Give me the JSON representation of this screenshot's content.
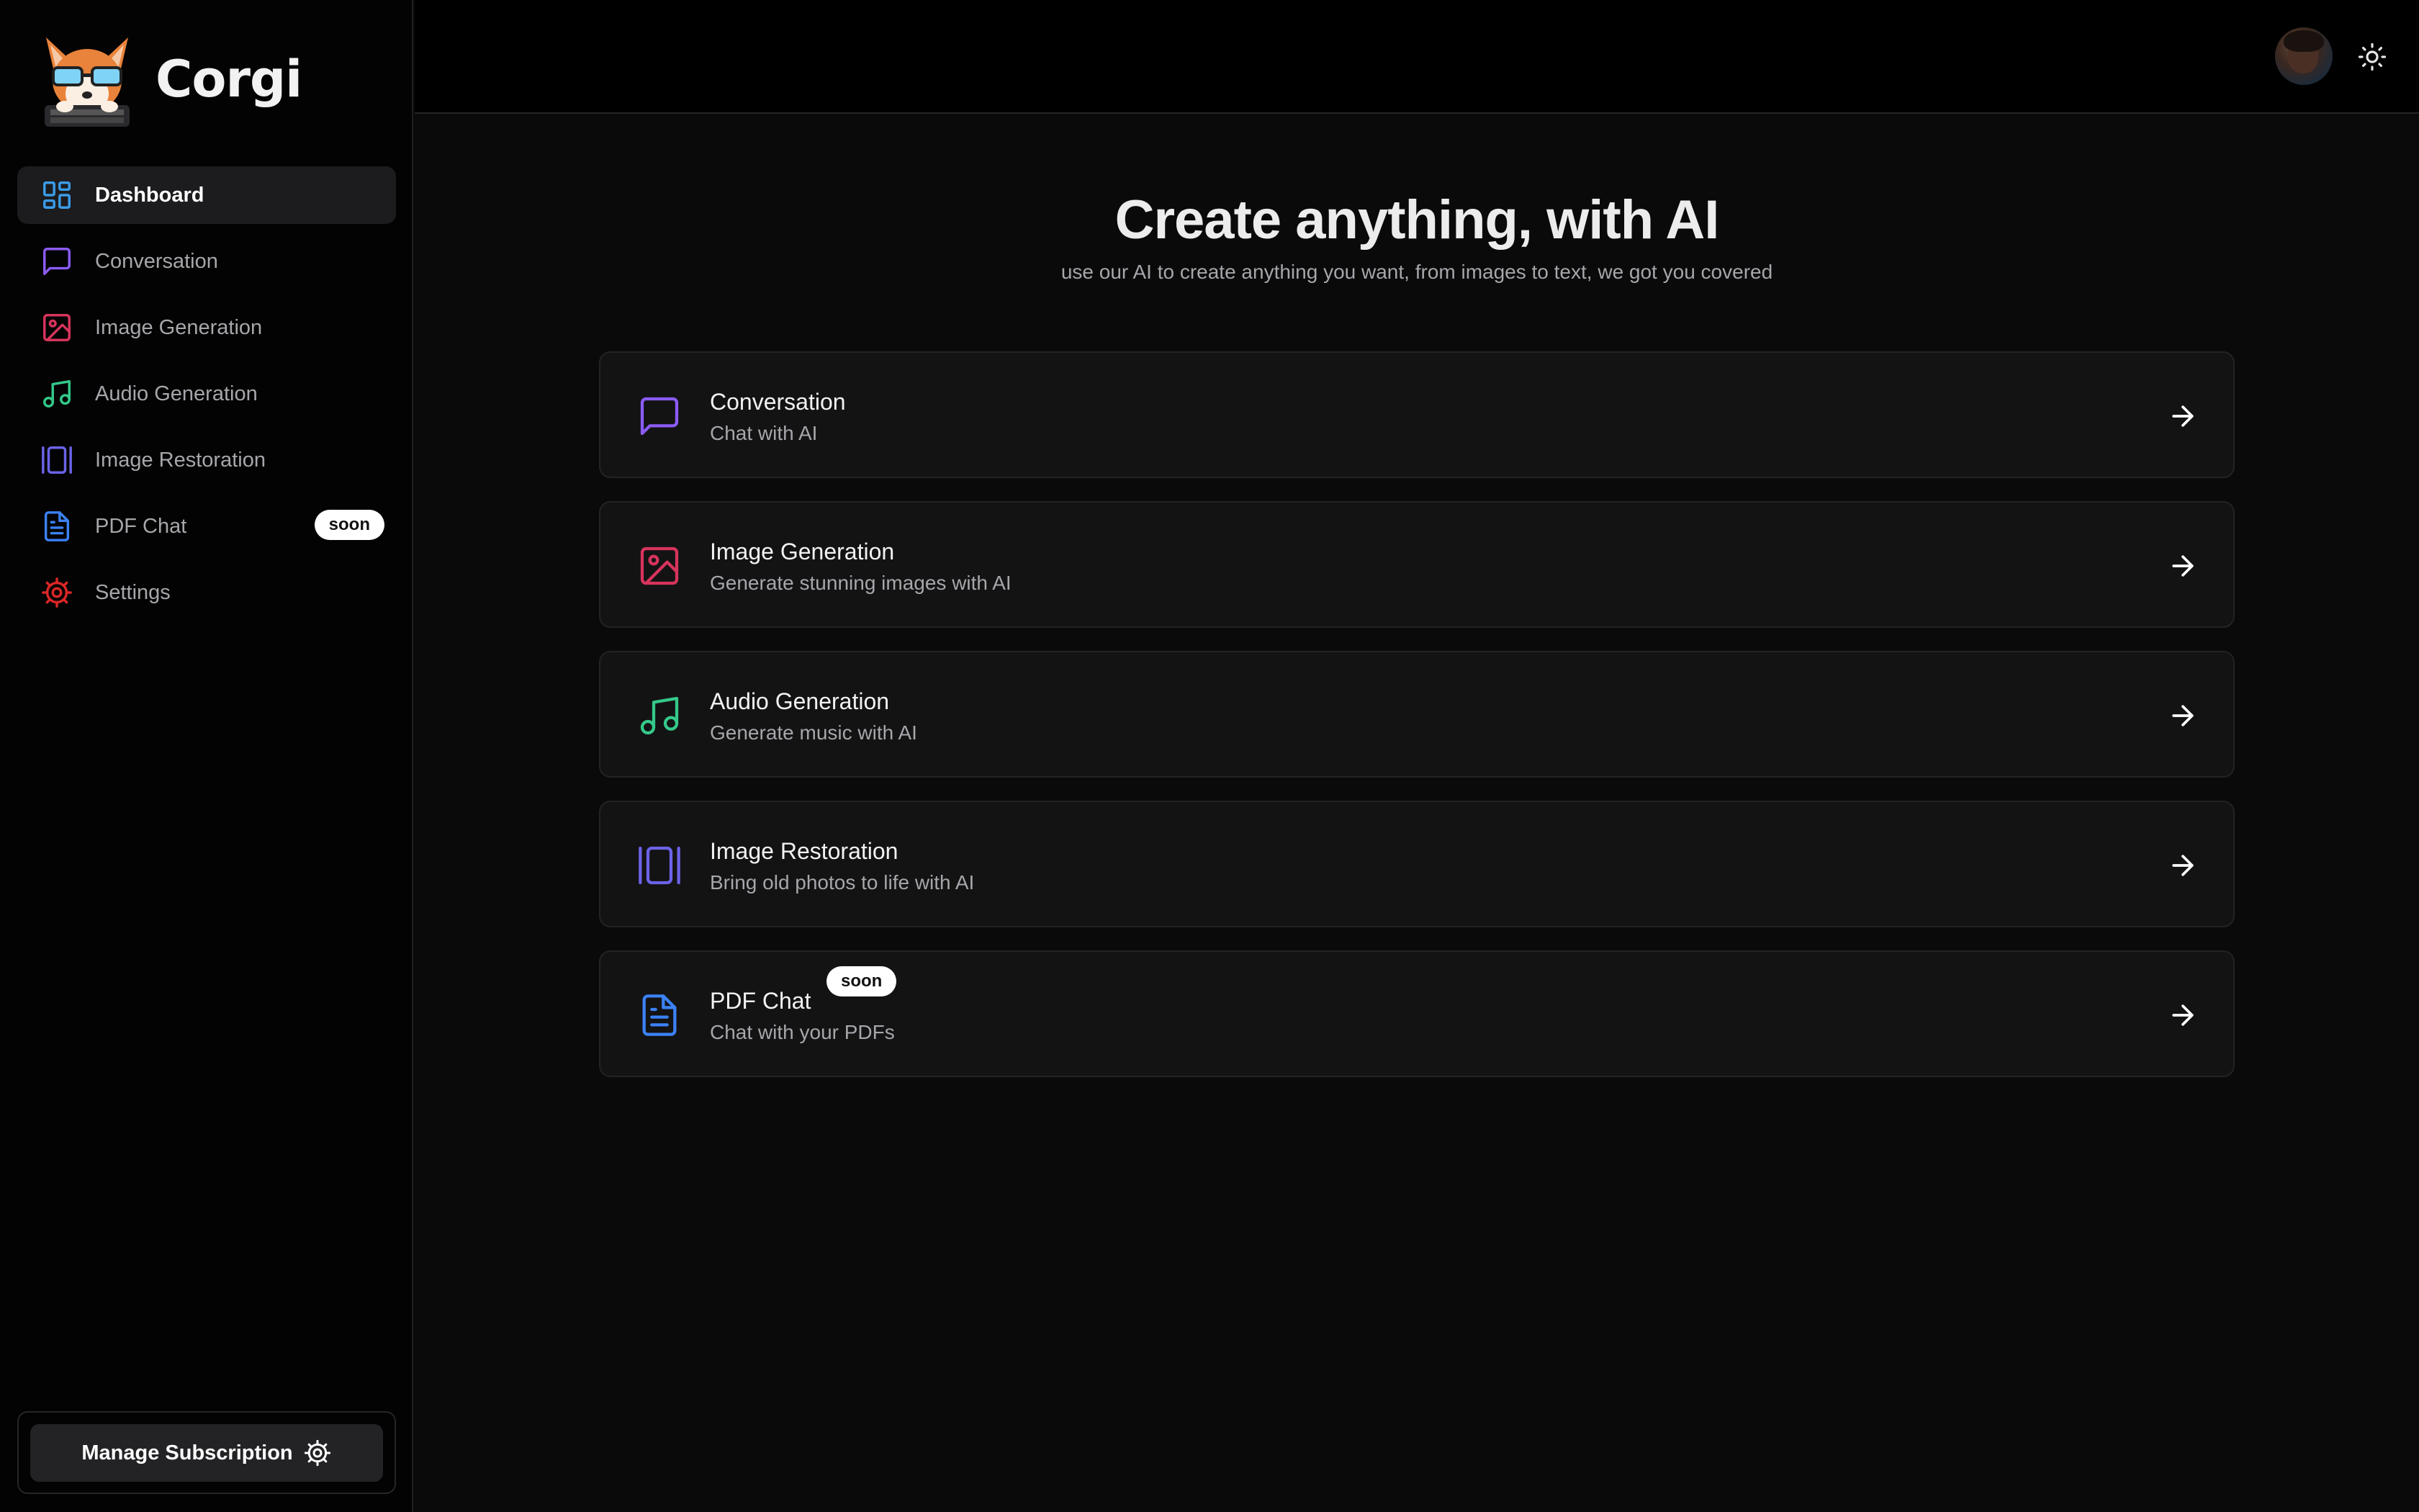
{
  "app": {
    "name": "Corgi"
  },
  "sidebar": {
    "items": [
      {
        "label": "Dashboard",
        "icon": "dashboard-icon",
        "color": "#3b9ce8",
        "active": true
      },
      {
        "label": "Conversation",
        "icon": "message-square-icon",
        "color": "#8b5cf6"
      },
      {
        "label": "Image Generation",
        "icon": "image-icon",
        "color": "#d7345d"
      },
      {
        "label": "Audio Generation",
        "icon": "music-icon",
        "color": "#34c98a"
      },
      {
        "label": "Image Restoration",
        "icon": "gallery-vertical-icon",
        "color": "#6c63e8"
      },
      {
        "label": "PDF Chat",
        "icon": "file-text-icon",
        "color": "#3b82f6",
        "badge": "soon"
      },
      {
        "label": "Settings",
        "icon": "gear-icon",
        "color": "#dc2626"
      }
    ],
    "manage_subscription_label": "Manage Subscription"
  },
  "main": {
    "title": "Create anything, with AI",
    "subtitle": "use our AI to create anything you want, from images to text, we got you covered",
    "cards": [
      {
        "title": "Conversation",
        "description": "Chat with AI",
        "icon": "message-square-icon",
        "color": "#8b5cf6"
      },
      {
        "title": "Image Generation",
        "description": "Generate stunning images with AI",
        "icon": "image-icon",
        "color": "#d7345d"
      },
      {
        "title": "Audio Generation",
        "description": "Generate music with AI",
        "icon": "music-icon",
        "color": "#34c98a"
      },
      {
        "title": "Image Restoration",
        "description": "Bring old photos to life with AI",
        "icon": "gallery-vertical-icon",
        "color": "#6c63e8"
      },
      {
        "title": "PDF Chat",
        "description": "Chat with your PDFs",
        "icon": "file-text-icon",
        "color": "#3b82f6",
        "badge": "soon"
      }
    ]
  },
  "topbar": {
    "avatar_icon": "user-avatar",
    "theme_icon": "sun-icon"
  }
}
